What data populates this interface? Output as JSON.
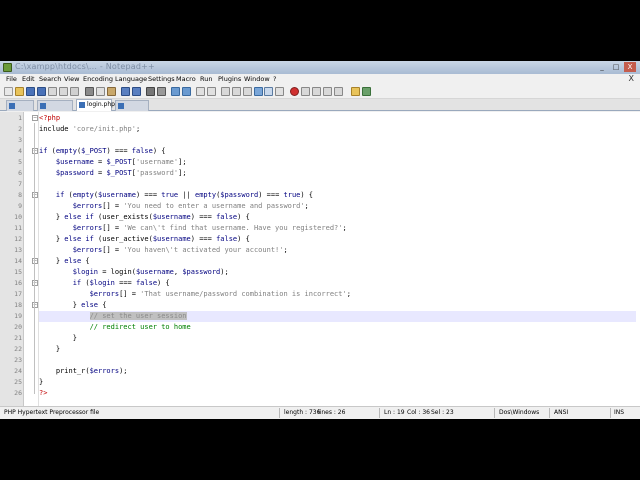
{
  "window": {
    "title": "C:\\xampp\\htdocs\\... - Notepad++",
    "buttons": [
      "_",
      "□",
      "X"
    ]
  },
  "menu": [
    "File",
    "Edit",
    "Search",
    "View",
    "Encoding",
    "Language",
    "Settings",
    "Macro",
    "Run",
    "Plugins",
    "Window",
    "?"
  ],
  "menu_close": "X",
  "tabs": [
    {
      "label": ""
    },
    {
      "label": ""
    },
    {
      "label": "login.php",
      "active": true
    },
    {
      "label": ""
    }
  ],
  "code": {
    "highlighted_line": 19,
    "lines": [
      {
        "n": "1",
        "segs": [
          [
            "php",
            "<?php"
          ]
        ]
      },
      {
        "n": "2",
        "segs": [
          [
            "op",
            "include "
          ],
          [
            "str",
            "'core/init.php'"
          ],
          [
            "op",
            ";"
          ]
        ]
      },
      {
        "n": "3",
        "segs": []
      },
      {
        "n": "4",
        "segs": [
          [
            "kw",
            "if"
          ],
          [
            "op",
            " ("
          ],
          [
            "kw",
            "empty"
          ],
          [
            "op",
            "("
          ],
          [
            "var",
            "$_POST"
          ],
          [
            "op",
            ") === "
          ],
          [
            "kw",
            "false"
          ],
          [
            "op",
            ") {"
          ]
        ]
      },
      {
        "n": "5",
        "segs": [
          [
            "op",
            "    "
          ],
          [
            "var",
            "$username"
          ],
          [
            "op",
            " = "
          ],
          [
            "var",
            "$_POST"
          ],
          [
            "op",
            "["
          ],
          [
            "str",
            "'username'"
          ],
          [
            "op",
            "];"
          ]
        ]
      },
      {
        "n": "6",
        "segs": [
          [
            "op",
            "    "
          ],
          [
            "var",
            "$password"
          ],
          [
            "op",
            " = "
          ],
          [
            "var",
            "$_POST"
          ],
          [
            "op",
            "["
          ],
          [
            "str",
            "'password'"
          ],
          [
            "op",
            "];"
          ]
        ]
      },
      {
        "n": "7",
        "segs": []
      },
      {
        "n": "8",
        "segs": [
          [
            "op",
            "    "
          ],
          [
            "kw",
            "if"
          ],
          [
            "op",
            " ("
          ],
          [
            "kw",
            "empty"
          ],
          [
            "op",
            "("
          ],
          [
            "var",
            "$username"
          ],
          [
            "op",
            ") === "
          ],
          [
            "kw",
            "true"
          ],
          [
            "op",
            " || "
          ],
          [
            "kw",
            "empty"
          ],
          [
            "op",
            "("
          ],
          [
            "var",
            "$password"
          ],
          [
            "op",
            ") === "
          ],
          [
            "kw",
            "true"
          ],
          [
            "op",
            ") {"
          ]
        ]
      },
      {
        "n": "9",
        "segs": [
          [
            "op",
            "        "
          ],
          [
            "var",
            "$errors"
          ],
          [
            "op",
            "[] = "
          ],
          [
            "str",
            "'You need to enter a username and password'"
          ],
          [
            "op",
            ";"
          ]
        ]
      },
      {
        "n": "10",
        "segs": [
          [
            "op",
            "    } "
          ],
          [
            "kw",
            "else if"
          ],
          [
            "op",
            " (user_exists("
          ],
          [
            "var",
            "$username"
          ],
          [
            "op",
            ") === "
          ],
          [
            "kw",
            "false"
          ],
          [
            "op",
            ") {"
          ]
        ]
      },
      {
        "n": "11",
        "segs": [
          [
            "op",
            "        "
          ],
          [
            "var",
            "$errors"
          ],
          [
            "op",
            "[] = "
          ],
          [
            "str",
            "'We can\\'t find that username. Have you registered?'"
          ],
          [
            "op",
            ";"
          ]
        ]
      },
      {
        "n": "12",
        "segs": [
          [
            "op",
            "    } "
          ],
          [
            "kw",
            "else if"
          ],
          [
            "op",
            " (user_active("
          ],
          [
            "var",
            "$username"
          ],
          [
            "op",
            ") === "
          ],
          [
            "kw",
            "false"
          ],
          [
            "op",
            ") {"
          ]
        ]
      },
      {
        "n": "13",
        "segs": [
          [
            "op",
            "        "
          ],
          [
            "var",
            "$errors"
          ],
          [
            "op",
            "[] = "
          ],
          [
            "str",
            "'You haven\\'t activated your account!'"
          ],
          [
            "op",
            ";"
          ]
        ]
      },
      {
        "n": "14",
        "segs": [
          [
            "op",
            "    } "
          ],
          [
            "kw",
            "else"
          ],
          [
            "op",
            " {"
          ]
        ]
      },
      {
        "n": "15",
        "segs": [
          [
            "op",
            "        "
          ],
          [
            "var",
            "$login"
          ],
          [
            "op",
            " = login("
          ],
          [
            "var",
            "$username"
          ],
          [
            "op",
            ", "
          ],
          [
            "var",
            "$password"
          ],
          [
            "op",
            ");"
          ]
        ]
      },
      {
        "n": "16",
        "segs": [
          [
            "op",
            "        "
          ],
          [
            "kw",
            "if"
          ],
          [
            "op",
            " ("
          ],
          [
            "var",
            "$login"
          ],
          [
            "op",
            " === "
          ],
          [
            "kw",
            "false"
          ],
          [
            "op",
            ") {"
          ]
        ]
      },
      {
        "n": "17",
        "segs": [
          [
            "op",
            "            "
          ],
          [
            "var",
            "$errors"
          ],
          [
            "op",
            "[] = "
          ],
          [
            "str",
            "'That username/password combination is incorrect'"
          ],
          [
            "op",
            ";"
          ]
        ]
      },
      {
        "n": "18",
        "segs": [
          [
            "op",
            "        } "
          ],
          [
            "kw",
            "else"
          ],
          [
            "op",
            " {"
          ]
        ]
      },
      {
        "n": "19",
        "segs": [
          [
            "op",
            "            "
          ],
          [
            "sel",
            "// set the user session"
          ]
        ]
      },
      {
        "n": "20",
        "segs": [
          [
            "op",
            "            "
          ],
          [
            "com",
            "// redirect user to home"
          ]
        ]
      },
      {
        "n": "21",
        "segs": [
          [
            "op",
            "        }"
          ]
        ]
      },
      {
        "n": "22",
        "segs": [
          [
            "op",
            "    }"
          ]
        ]
      },
      {
        "n": "23",
        "segs": []
      },
      {
        "n": "24",
        "segs": [
          [
            "op",
            "    print_r("
          ],
          [
            "var",
            "$errors"
          ],
          [
            "op",
            ");"
          ]
        ]
      },
      {
        "n": "25",
        "segs": [
          [
            "op",
            "}"
          ]
        ]
      },
      {
        "n": "26",
        "segs": [
          [
            "php",
            "?>"
          ]
        ]
      }
    ]
  },
  "status": {
    "file_type": "PHP Hypertext Preprocessor file",
    "length": "length : 736",
    "lines": "lines : 26",
    "ln": "Ln : 19",
    "col": "Col : 36",
    "sel": "Sel : 23",
    "eol": "Dos\\Windows",
    "encoding": "ANSI",
    "mode": "INS"
  },
  "colors": {
    "keyword": "#000080",
    "string": "#808080",
    "comment": "#008000",
    "php_tag": "#c00000",
    "current_line": "#e8e8ff"
  }
}
